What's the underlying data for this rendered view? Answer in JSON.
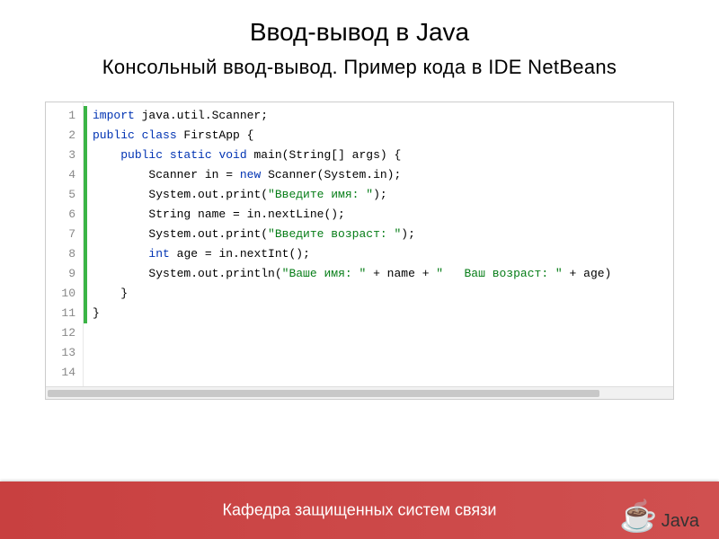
{
  "title": "Ввод-вывод в Java",
  "subtitle": "Консольный ввод-вывод. Пример кода в IDE NetBeans",
  "footer": "Кафедра защищенных систем связи",
  "java_label": "Java",
  "gutter": [
    "1",
    "2",
    "3",
    "4",
    "5",
    "6",
    "7",
    "8",
    "9",
    "10",
    "11",
    "12",
    "13",
    "14"
  ],
  "code": {
    "line1": {
      "kw1": "import",
      "pkg": " java.util.Scanner;"
    },
    "line3": {
      "kw1": "public ",
      "kw2": "class ",
      "cls": "FirstApp",
      "rest": " {"
    },
    "line5": {
      "indent": "    ",
      "kw1": "public ",
      "kw2": "static ",
      "kw3": "void ",
      "name": "main(String[] args) {"
    },
    "line7": {
      "indent": "        ",
      "a": "Scanner in = ",
      "kw": "new ",
      "b": "Scanner(System.in);"
    },
    "line8": {
      "indent": "        ",
      "a": "System.out.print(",
      "str": "\"Введите имя: \"",
      "b": ");"
    },
    "line9": {
      "indent": "        ",
      "a": "String name = in.nextLine();"
    },
    "line10": {
      "indent": "        ",
      "a": "System.out.print(",
      "str": "\"Введите возраст: \"",
      "b": ");"
    },
    "line11": {
      "indent": "        ",
      "kw": "int ",
      "a": "age = in.nextInt();"
    },
    "line12": {
      "indent": "        ",
      "a": "System.out.println(",
      "str1": "\"Ваше имя: \"",
      "b": " + name + ",
      "str2": "\"   Ваш возраст: \"",
      "c": " + age)"
    },
    "line13": {
      "indent": "    ",
      "a": "}"
    },
    "line14": {
      "a": "}"
    }
  }
}
